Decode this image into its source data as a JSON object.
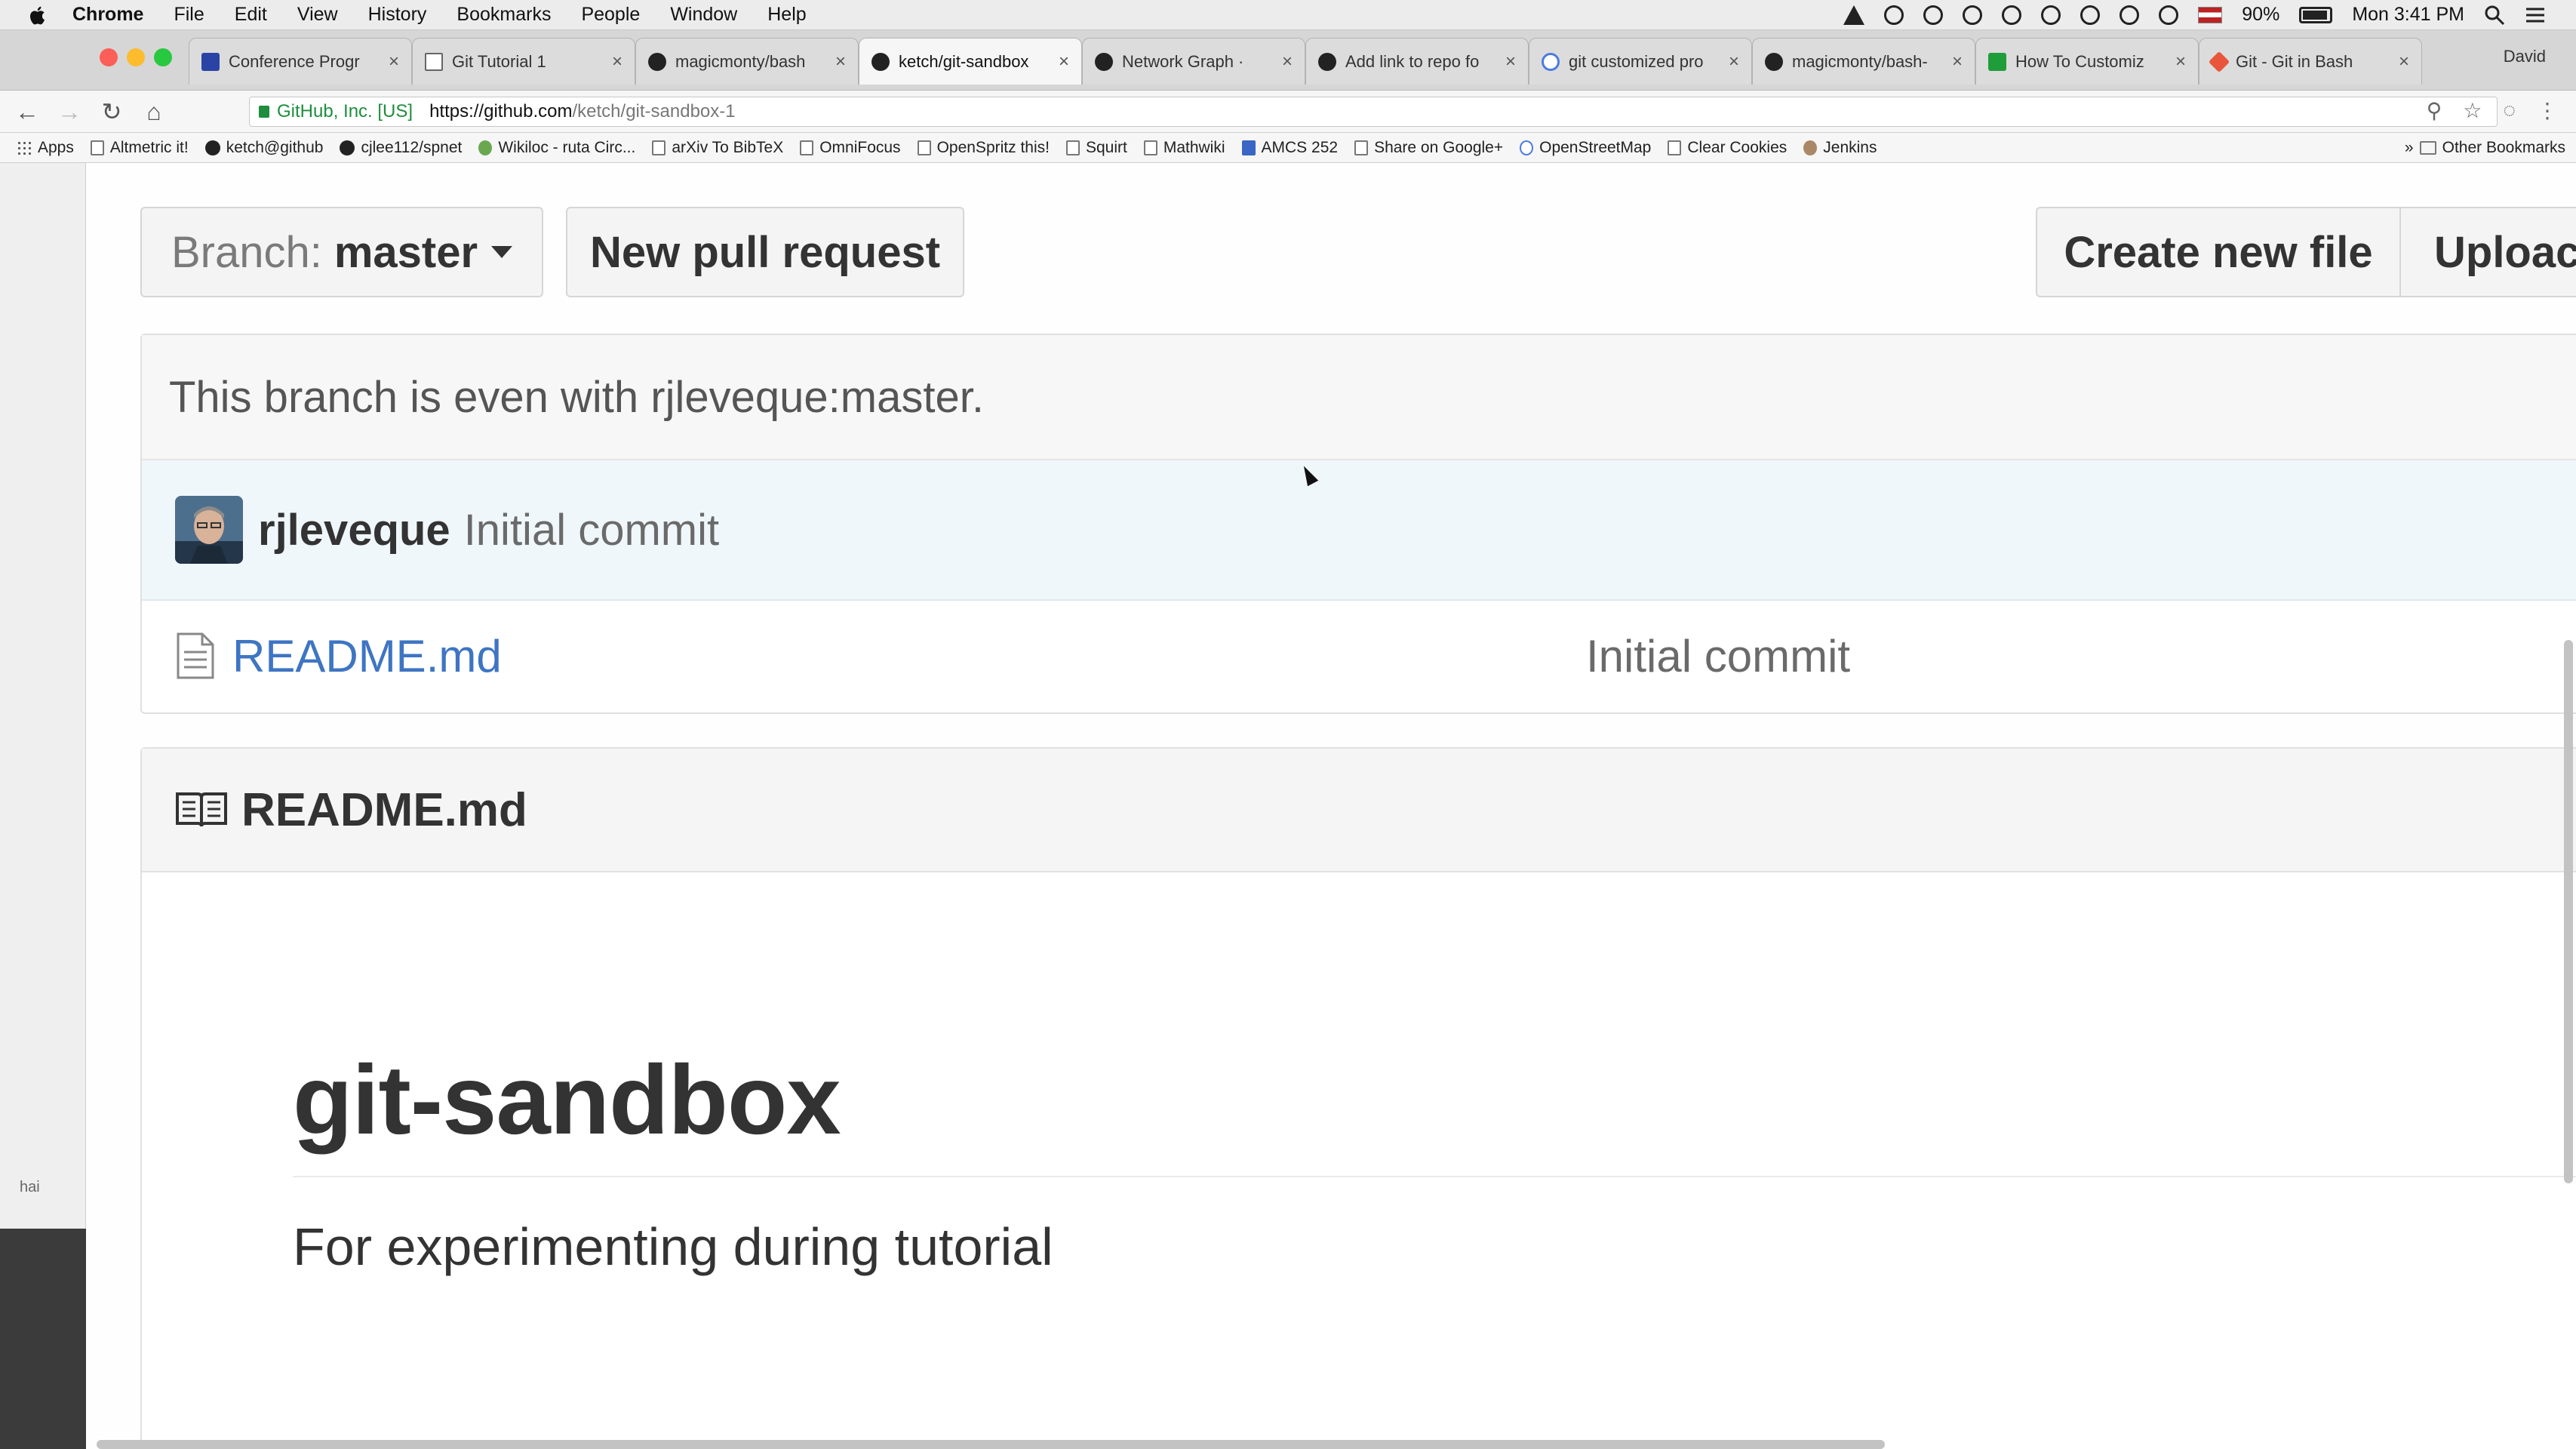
{
  "menubar": {
    "app": "Chrome",
    "items": [
      "File",
      "Edit",
      "View",
      "History",
      "Bookmarks",
      "People",
      "Window",
      "Help"
    ],
    "battery": "90%",
    "clock": "Mon 3:41 PM"
  },
  "tabs": [
    {
      "title": "Conference Progr",
      "icon": "blue"
    },
    {
      "title": "Git Tutorial 1",
      "icon": "doc"
    },
    {
      "title": "magicmonty/bash",
      "icon": "github"
    },
    {
      "title": "ketch/git-sandbox",
      "icon": "github"
    },
    {
      "title": "Network Graph · ",
      "icon": "github"
    },
    {
      "title": "Add link to repo fo",
      "icon": "github"
    },
    {
      "title": "git customized pro",
      "icon": "google"
    },
    {
      "title": "magicmonty/bash-",
      "icon": "github"
    },
    {
      "title": "How To Customiz",
      "icon": "green"
    },
    {
      "title": "Git - Git in Bash",
      "icon": "orange"
    }
  ],
  "profile": "David",
  "address": {
    "secure_label": "GitHub, Inc. [US]",
    "host": "https://github.com",
    "path": "/ketch/git-sandbox-1"
  },
  "bookmarks": [
    {
      "label": "Apps",
      "icon": "apps"
    },
    {
      "label": "Altmetric it!",
      "icon": "doc"
    },
    {
      "label": "ketch@github",
      "icon": "github"
    },
    {
      "label": "cjlee112/spnet",
      "icon": "github"
    },
    {
      "label": "Wikiloc - ruta Circ...",
      "icon": "green"
    },
    {
      "label": "arXiv To BibTeX",
      "icon": "doc"
    },
    {
      "label": "OmniFocus",
      "icon": "doc"
    },
    {
      "label": "OpenSpritz this!",
      "icon": "doc"
    },
    {
      "label": "Squirt",
      "icon": "doc"
    },
    {
      "label": "Mathwiki",
      "icon": "doc"
    },
    {
      "label": "AMCS 252",
      "icon": "blue"
    },
    {
      "label": "Share on Google+",
      "icon": "doc"
    },
    {
      "label": "OpenStreetMap",
      "icon": "g"
    },
    {
      "label": "Clear Cookies",
      "icon": "doc"
    },
    {
      "label": "Jenkins",
      "icon": "person"
    }
  ],
  "other_bookmarks": "Other Bookmarks",
  "left_panel_text": "hai",
  "repo": {
    "branch_label": "Branch:",
    "branch_name": "master",
    "new_pr": "New pull request",
    "create_file": "Create new file",
    "upload": "Uploac",
    "branch_status": "This branch is even with rjleveque:master.",
    "commit_author": "rjleveque",
    "commit_message": "Initial commit",
    "files": [
      {
        "name": "README.md",
        "last_commit": "Initial commit"
      }
    ],
    "readme_file": "README.md",
    "readme_heading": "git-sandbox",
    "readme_description": "For experimenting during tutorial"
  },
  "colors": {
    "link": "#3e75c3",
    "commit_row_bg": "#f0f7fb",
    "secure_green": "#1e8e3e"
  }
}
